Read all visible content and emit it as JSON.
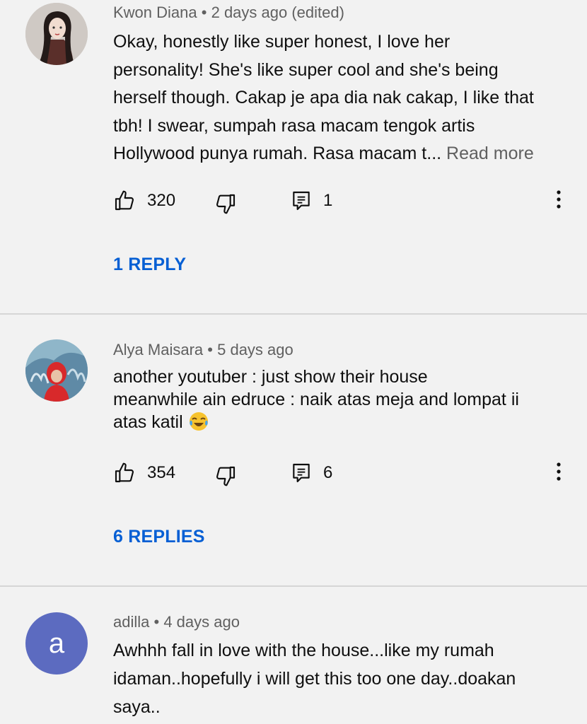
{
  "comments": [
    {
      "author": "Kwon Diana",
      "sep": "•",
      "time": "2 days ago (edited)",
      "lines": [
        "Okay, honestly like super honest, I love her",
        "personality! She's like super cool and she's being",
        "herself though. Cakap je apa dia nak cakap, I like that",
        "tbh! I swear, sumpah rasa macam tengok artis",
        "Hollywood punya rumah. Rasa macam t..."
      ],
      "read_more": "Read more",
      "likes": "320",
      "reply_count": "1",
      "replies_label": "1 REPLY"
    },
    {
      "author": "Alya Maisara",
      "sep": "•",
      "time": "5 days ago",
      "lines": [
        "another youtuber : just show their house",
        "meanwhile ain edruce : naik atas meja and lompat ii",
        "atas katil"
      ],
      "emoji": "face-with-tears-of-joy-emoji",
      "likes": "354",
      "reply_count": "6",
      "replies_label": "6 REPLIES"
    },
    {
      "author": "adilla",
      "sep": "•",
      "time": "4 days ago",
      "avatar_letter": "a",
      "lines": [
        "Awhhh fall in love with the house...like my rumah",
        "idaman..hopefully i will get this too one day..doakan",
        "saya.."
      ]
    }
  ],
  "icons": {
    "like": "thumbs-up-icon",
    "dislike": "thumbs-down-icon",
    "reply": "comment-icon",
    "more": "more-vert-icon"
  },
  "colors": {
    "background": "#f2f2f2",
    "link_blue": "#065fd4",
    "meta_grey": "#606060",
    "avatar_purple": "#5c6bc0"
  }
}
